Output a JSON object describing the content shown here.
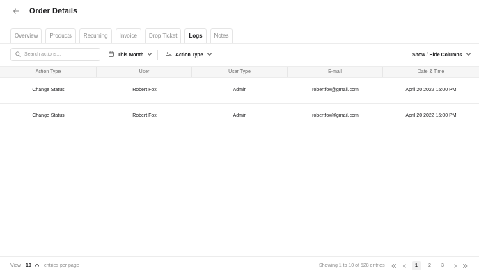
{
  "header": {
    "title": "Order Details",
    "back_icon": "arrow-left-icon"
  },
  "tabs": [
    {
      "label": "Overview",
      "active": false
    },
    {
      "label": "Products",
      "active": false
    },
    {
      "label": "Recurring",
      "active": false
    },
    {
      "label": "Invoice",
      "active": false
    },
    {
      "label": "Drop Ticket",
      "active": false
    },
    {
      "label": "Logs",
      "active": true
    },
    {
      "label": "Notes",
      "active": false
    }
  ],
  "toolbar": {
    "search_placeholder": "Search actions...",
    "date_filter": "This Month",
    "type_filter": "Action Type",
    "columns_toggle": "Show / Hide Columns"
  },
  "table": {
    "columns": [
      "Action Type",
      "User",
      "User Type",
      "E-mail",
      "Date & Time"
    ],
    "rows": [
      [
        "Change Status",
        "Robert Fox",
        "Admin",
        "robertfox@gmail.com",
        "April 20 2022 15:00 PM"
      ],
      [
        "Change Status",
        "Robert Fox",
        "Admin",
        "robertfox@gmail.com",
        "April 20 2022 15:00 PM"
      ]
    ]
  },
  "footer": {
    "view_label": "View",
    "per_page": "10",
    "per_page_suffix": "entries per page",
    "showing": "Showing 1 to 10 of 528 entries",
    "pages": [
      "1",
      "2",
      "3"
    ],
    "current_page": "1"
  },
  "colors": {
    "text": "#1c1c1e",
    "muted": "#8a8a8a",
    "border": "#ececec",
    "header_bg": "#f6f6f6"
  }
}
